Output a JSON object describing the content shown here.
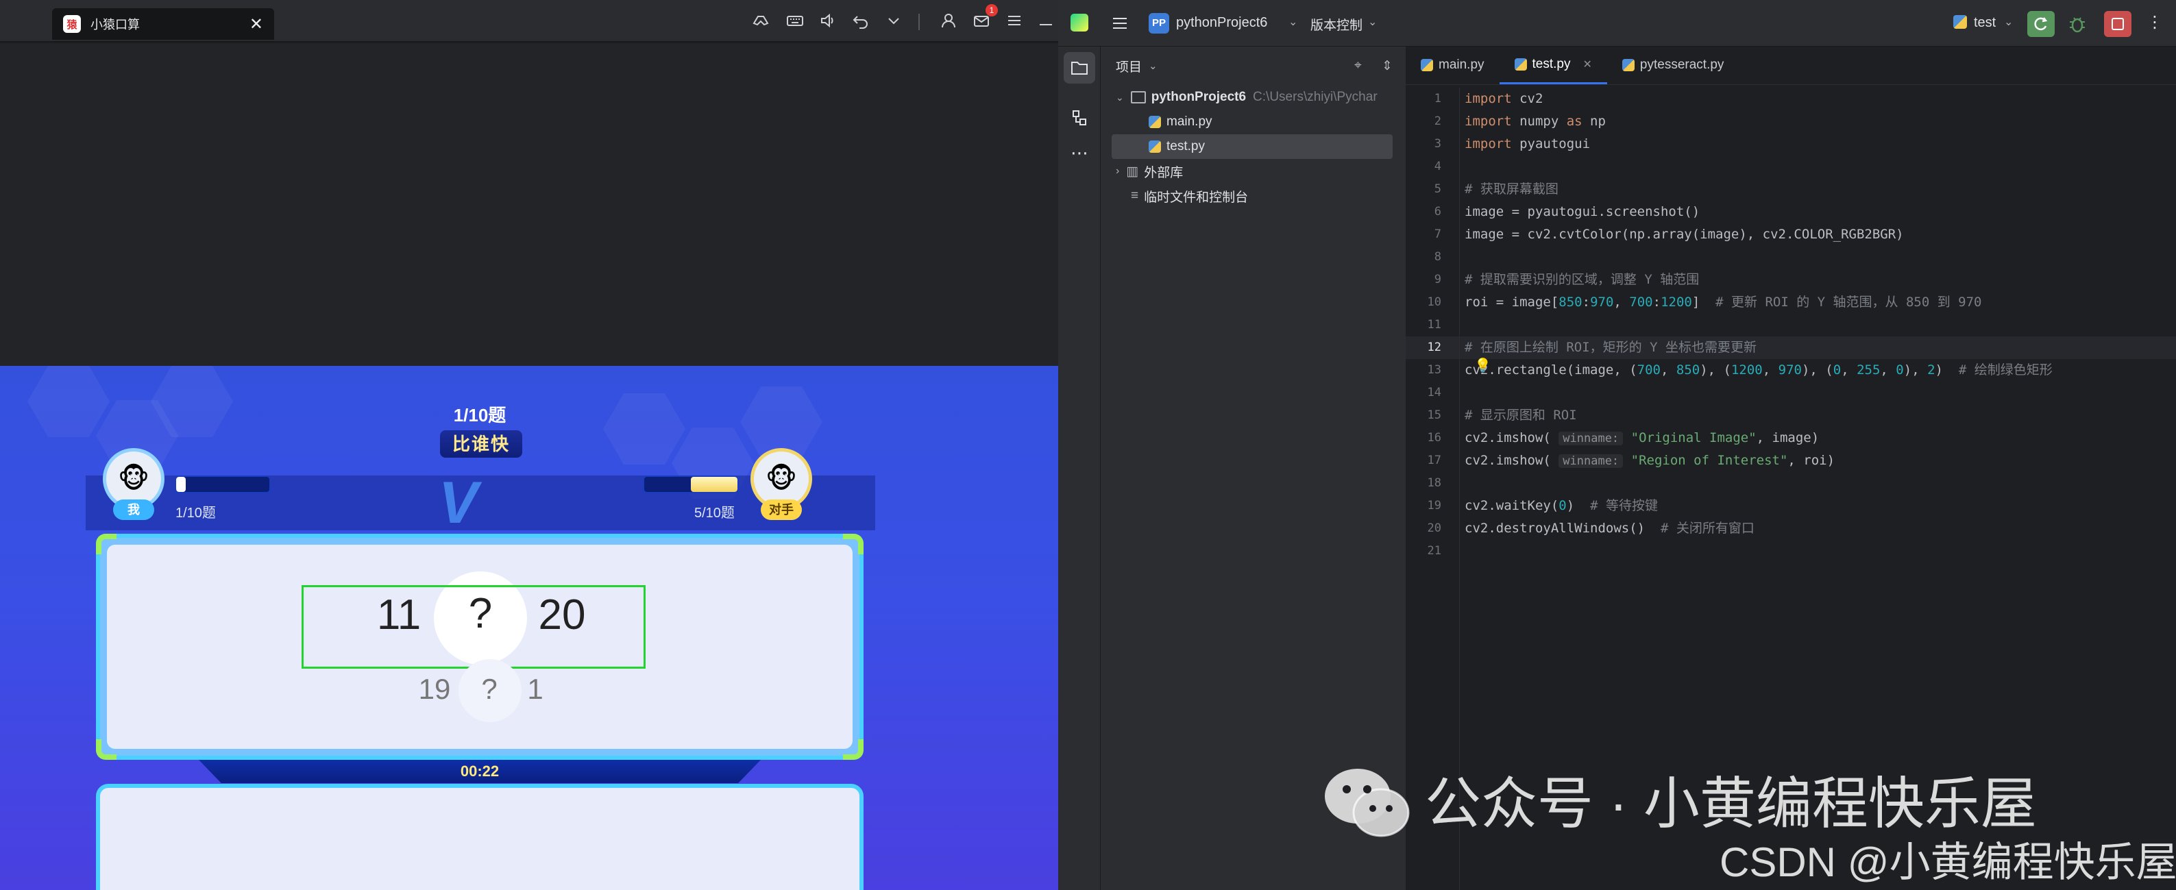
{
  "emulator": {
    "tab_title": "小猿口算",
    "tab_logo": "猿",
    "close_glyph": "✕",
    "mail_badge": "1",
    "icons": [
      "controller-icon",
      "keyboard-icon",
      "volume-icon",
      "undo-icon",
      "chevron-down-icon",
      "user-icon",
      "mail-icon",
      "menu-icon",
      "minimize-icon"
    ]
  },
  "game": {
    "question_count": "1/10题",
    "title": "比谁快",
    "me_label": "我",
    "opp_label": "对手",
    "me_progress_text": "1/10题",
    "opp_progress_text": "5/10题",
    "me_progress": 0.1,
    "opp_progress": 0.5,
    "vs": "V",
    "main_left": "11",
    "main_op": "?",
    "main_right": "20",
    "next_left": "19",
    "next_op": "?",
    "next_right": "1",
    "timer": "00:22"
  },
  "ide": {
    "project_badge": "PP",
    "project_name": "pythonProject6",
    "vcs_label": "版本控制",
    "run_config": "test",
    "project_panel_title": "项目",
    "root_folder": "pythonProject6",
    "root_path": "C:\\Users\\zhiyi\\Pychar",
    "files": [
      "main.py",
      "test.py"
    ],
    "external_libs": "外部库",
    "scratches": "临时文件和控制台",
    "tabs": [
      "main.py",
      "test.py",
      "pytesseract.py"
    ],
    "active_tab": "test.py",
    "current_line": 12,
    "code_lines": [
      "import cv2",
      "import numpy as np",
      "import pyautogui",
      "",
      "# 获取屏幕截图",
      "image = pyautogui.screenshot()",
      "image = cv2.cvtColor(np.array(image), cv2.COLOR_RGB2BGR)",
      "",
      "# 提取需要识别的区域，调整 Y 轴范围",
      "roi = image[850:970, 700:1200]  # 更新 ROI 的 Y 轴范围，从 850 到 970",
      "",
      "# 在原图上绘制 ROI，矩形的 Y 坐标也需要更新",
      "cv2.rectangle(image, (700, 850), (1200, 970), (0, 255, 0), 2)  # 绘制绿色矩形",
      "",
      "# 显示原图和 ROI",
      "cv2.imshow( winname: \"Original Image\", image)",
      "cv2.imshow( winname: \"Region of Interest\", roi)",
      "",
      "cv2.waitKey(0)  # 等待按键",
      "cv2.destroyAllWindows()  # 关闭所有窗口",
      ""
    ]
  },
  "watermark": {
    "line1": "公众号 · 小黄编程快乐屋",
    "line2": "CSDN @小黄编程快乐屋"
  },
  "colors": {
    "ide_bg": "#1e1f22",
    "keyword": "#cf8e6d",
    "string": "#6aab73",
    "number": "#2aacb8",
    "comment": "#7a7e85",
    "roi_box": "#23d42f",
    "game_bg": "#3a4fe5"
  }
}
